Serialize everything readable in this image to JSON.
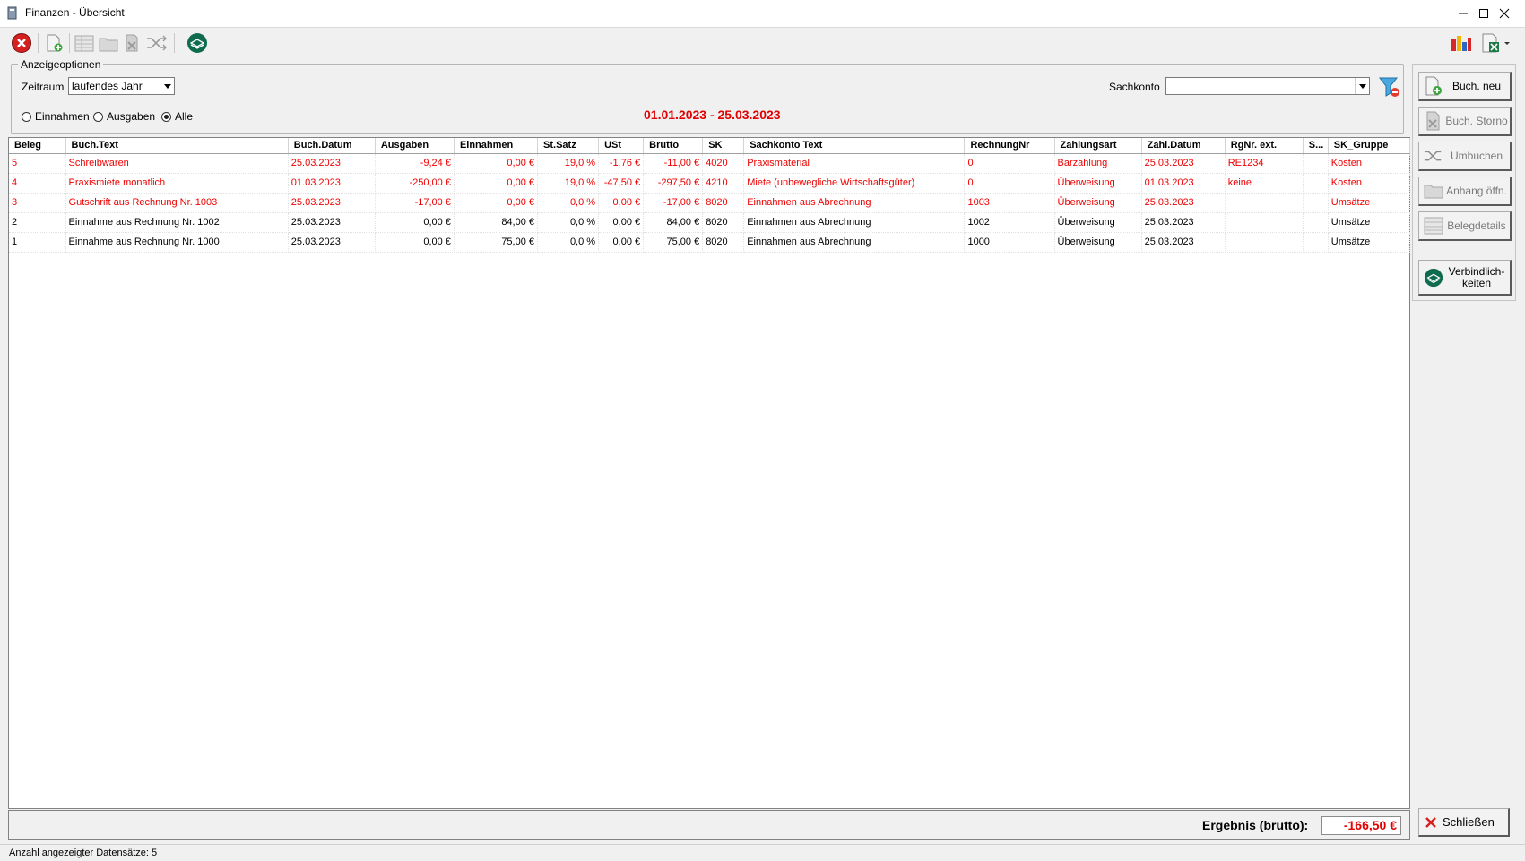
{
  "window": {
    "title": "Finanzen - Übersicht"
  },
  "options": {
    "legend": "Anzeigeoptionen",
    "zeitraum_label": "Zeitraum",
    "zeitraum_value": "laufendes Jahr",
    "sachkonto_label": "Sachkonto",
    "sachkonto_value": "",
    "radio_einnahmen": "Einnahmen",
    "radio_ausgaben": "Ausgaben",
    "radio_alle": "Alle",
    "selected_radio": "Alle",
    "date_range": "01.01.2023 - 25.03.2023"
  },
  "table": {
    "columns": [
      "Beleg",
      "Buch.Text",
      "Buch.Datum",
      "Ausgaben",
      "Einnahmen",
      "St.Satz",
      "USt",
      "Brutto",
      "SK",
      "Sachkonto Text",
      "RechnungNr",
      "Zahlungsart",
      "Zahl.Datum",
      "RgNr. ext.",
      "S...",
      "SK_Gruppe"
    ],
    "rows": [
      {
        "red": true,
        "cells": [
          "5",
          "Schreibwaren",
          "25.03.2023",
          "-9,24 €",
          "0,00 €",
          "19,0 %",
          "-1,76 €",
          "-11,00 €",
          "4020",
          "Praxismaterial",
          "0",
          "Barzahlung",
          "25.03.2023",
          "RE1234",
          "",
          "Kosten"
        ]
      },
      {
        "red": true,
        "cells": [
          "4",
          "Praxismiete monatlich",
          "01.03.2023",
          "-250,00 €",
          "0,00 €",
          "19,0 %",
          "-47,50 €",
          "-297,50 €",
          "4210",
          "Miete (unbewegliche Wirtschaftsgüter)",
          "0",
          "Überweisung",
          "01.03.2023",
          "keine",
          "",
          "Kosten"
        ]
      },
      {
        "red": true,
        "cells": [
          "3",
          "Gutschrift aus Rechnung Nr. 1003",
          "25.03.2023",
          "-17,00 €",
          "0,00 €",
          "0,0 %",
          "0,00 €",
          "-17,00 €",
          "8020",
          "Einnahmen aus Abrechnung",
          "1003",
          "Überweisung",
          "25.03.2023",
          "",
          "",
          "Umsätze"
        ]
      },
      {
        "red": false,
        "cells": [
          "2",
          "Einnahme aus Rechnung Nr. 1002",
          "25.03.2023",
          "0,00 €",
          "84,00 €",
          "0,0 %",
          "0,00 €",
          "84,00 €",
          "8020",
          "Einnahmen aus Abrechnung",
          "1002",
          "Überweisung",
          "25.03.2023",
          "",
          "",
          "Umsätze"
        ]
      },
      {
        "red": false,
        "cells": [
          "1",
          "Einnahme aus Rechnung Nr. 1000",
          "25.03.2023",
          "0,00 €",
          "75,00 €",
          "0,0 %",
          "0,00 €",
          "75,00 €",
          "8020",
          "Einnahmen aus Abrechnung",
          "1000",
          "Überweisung",
          "25.03.2023",
          "",
          "",
          "Umsätze"
        ]
      }
    ]
  },
  "sidebar": {
    "buch_neu": "Buch. neu",
    "buch_storno": "Buch. Storno",
    "umbuchen": "Umbuchen",
    "anhang": "Anhang öffn.",
    "belegdetails": "Belegdetails",
    "verbindlichkeiten": "Verbindlich-\nkeiten"
  },
  "footer": {
    "result_label": "Ergebnis (brutto):",
    "result_value": "-166,50 €",
    "close_label": "Schließen",
    "status": "Anzahl angezeigter Datensätze: 5"
  },
  "colors": {
    "negative": "#ef0000",
    "accent_green": "#0e6b4e"
  },
  "icons": {
    "toolbar": [
      "close-circle-icon",
      "new-document-icon",
      "table-icon",
      "folder-icon",
      "storno-icon",
      "shuffle-icon",
      "layers-icon"
    ],
    "toolbar_right": [
      "bar-chart-icon",
      "excel-export-icon"
    ],
    "filter": "filter-remove-icon"
  }
}
